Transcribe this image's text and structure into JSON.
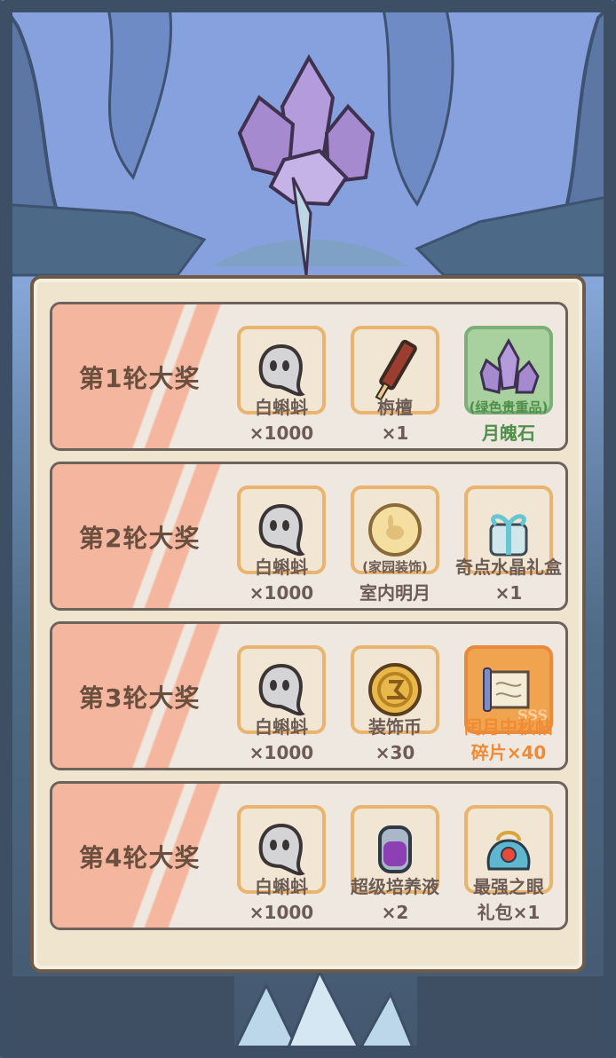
{
  "rounds": [
    {
      "title": "第1轮大奖",
      "items": [
        {
          "icon": "white-tadpole-icon",
          "name": "白蝌蚪",
          "qty": "×1000"
        },
        {
          "icon": "sandalwood-icon",
          "name": "栴檀",
          "qty": "×1"
        },
        {
          "icon": "moon-soul-stone-icon",
          "tag": "(绿色贵重品)",
          "name": "月魄石",
          "style": "green"
        }
      ]
    },
    {
      "title": "第2轮大奖",
      "items": [
        {
          "icon": "white-tadpole-icon",
          "name": "白蝌蚪",
          "qty": "×1000"
        },
        {
          "icon": "moon-decoration-icon",
          "tag": "(家园装饰)",
          "name": "室内明月"
        },
        {
          "icon": "crystal-gift-box-icon",
          "name": "奇点水晶礼盒",
          "qty": "×1"
        }
      ]
    },
    {
      "title": "第3轮大奖",
      "items": [
        {
          "icon": "white-tadpole-icon",
          "name": "白蝌蚪",
          "qty": "×1000"
        },
        {
          "icon": "decoration-coin-icon",
          "name": "装饰币",
          "qty": "×30"
        },
        {
          "icon": "scroll-fragment-icon",
          "name": "闰月中秋帖",
          "qty": "碎片×40",
          "style": "orange",
          "badge": "SSS"
        }
      ]
    },
    {
      "title": "第4轮大奖",
      "items": [
        {
          "icon": "white-tadpole-icon",
          "name": "白蝌蚪",
          "qty": "×1000"
        },
        {
          "icon": "culture-liquid-icon",
          "name": "超级培养液",
          "qty": "×2"
        },
        {
          "icon": "strongest-eye-bag-icon",
          "name": "最强之眼",
          "qty": "礼包×1"
        }
      ]
    }
  ],
  "colors": {
    "panel": "#efe5cf",
    "stripe": "#f5b69f",
    "title": "#6a4f3e",
    "green": "#4f8f4a",
    "orange": "#f08a35"
  }
}
